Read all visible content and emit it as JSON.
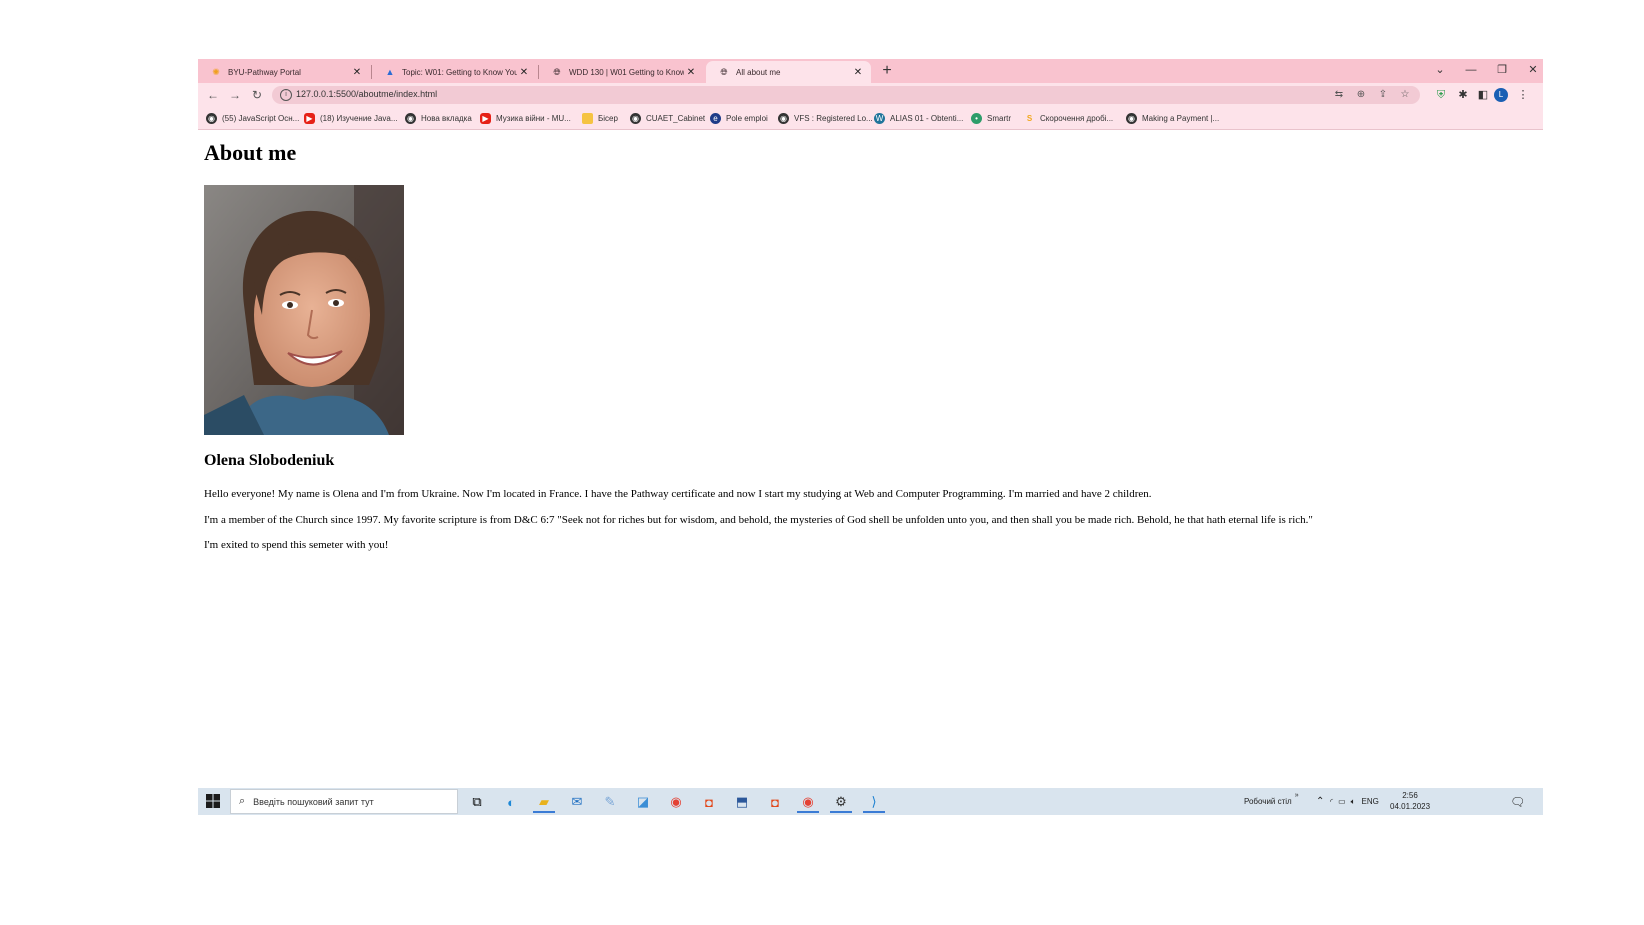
{
  "browser": {
    "tabs": [
      {
        "title": "BYU-Pathway Portal",
        "icon": "pathway-icon",
        "active": false
      },
      {
        "title": "Topic: W01: Getting to Know You",
        "icon": "canvas-icon",
        "active": false
      },
      {
        "title": "WDD 130 | W01 Getting to Know",
        "icon": "globe-icon",
        "active": false
      },
      {
        "title": "All about me",
        "icon": "globe-icon",
        "active": true
      }
    ],
    "new_tab": "+",
    "controls": {
      "dropdown": "⌄",
      "minimize": "—",
      "restore": "❐",
      "close": "✕"
    },
    "address": {
      "url": "127.0.0.1:5500/aboutme/index.html"
    },
    "profile_initial": "L",
    "bookmarks": [
      {
        "label": "(55) JavaScript Осн...",
        "icon": "globe-icon",
        "color": "#333333"
      },
      {
        "label": "(18) Изучение Java...",
        "icon": "youtube-icon",
        "color": "#e62117"
      },
      {
        "label": "Нова вкладка",
        "icon": "globe-icon",
        "color": "#333333"
      },
      {
        "label": "Музика війни - MU...",
        "icon": "youtube-icon",
        "color": "#e62117"
      },
      {
        "label": "Бісер",
        "icon": "folder-icon",
        "color": "#f5c342"
      },
      {
        "label": "CUAET_Cabinet",
        "icon": "globe-icon",
        "color": "#333333"
      },
      {
        "label": "Pole emploi",
        "icon": "pole-emploi-icon",
        "color": "#1f3c88"
      },
      {
        "label": "VFS : Registered Lo...",
        "icon": "globe-icon",
        "color": "#333333"
      },
      {
        "label": "ALIAS 01 - Obtenti...",
        "icon": "wordpress-icon",
        "color": "#21759b"
      },
      {
        "label": "Smartr",
        "icon": "smartr-icon",
        "color": "#2e9d6a"
      },
      {
        "label": "Скорочення дробі...",
        "icon": "s-icon",
        "color": "#f2a81d"
      },
      {
        "label": "Making a Payment |...",
        "icon": "globe-icon",
        "color": "#333333"
      }
    ]
  },
  "page": {
    "heading": "About me",
    "name": "Olena Slobodeniuk",
    "paragraphs": [
      "Hello everyone! My name is Olena and I'm from Ukraine. Now I'm located in France. I have the Pathway certificate and now I start my studying at Web and Computer Programming. I'm married and have 2 children.",
      "I'm a member of the Church since 1997. My favorite scripture is from D&C 6:7 \"Seek not for riches but for wisdom, and behold, the mysteries of God shell be unfolden unto you, and then shall you be made rich. Behold, he that hath eternal life is rich.\"",
      "I'm exited to spend this semeter with you!"
    ]
  },
  "taskbar": {
    "search_placeholder": "Введіть пошуковий запит тут",
    "desktop_label": "Робочий стіл",
    "language": "ENG",
    "time": "2:56",
    "date": "04.01.2023"
  },
  "colors": {
    "tabstrip": "#f9c3cf",
    "toolbar": "#fde3ea",
    "taskbar": "#d9e4ee"
  }
}
